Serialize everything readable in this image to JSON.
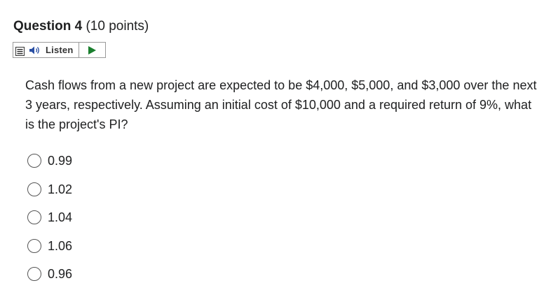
{
  "question": {
    "title": "Question 4",
    "points": "(10 points)",
    "text": "Cash flows from a new project are expected to be $4,000, $5,000, and $3,000 over the next 3 years, respectively. Assuming an initial cost of $10,000 and a required return of 9%, what is the project's PI?"
  },
  "listen": {
    "label": "Listen",
    "menu_icon": "menu-icon",
    "speaker_icon": "speaker-icon",
    "play_icon": "play-icon",
    "accent_color": "#1a7f2e"
  },
  "options": [
    {
      "label": "0.99",
      "selected": false
    },
    {
      "label": "1.02",
      "selected": false
    },
    {
      "label": "1.04",
      "selected": false
    },
    {
      "label": "1.06",
      "selected": false
    },
    {
      "label": "0.96",
      "selected": false
    }
  ]
}
